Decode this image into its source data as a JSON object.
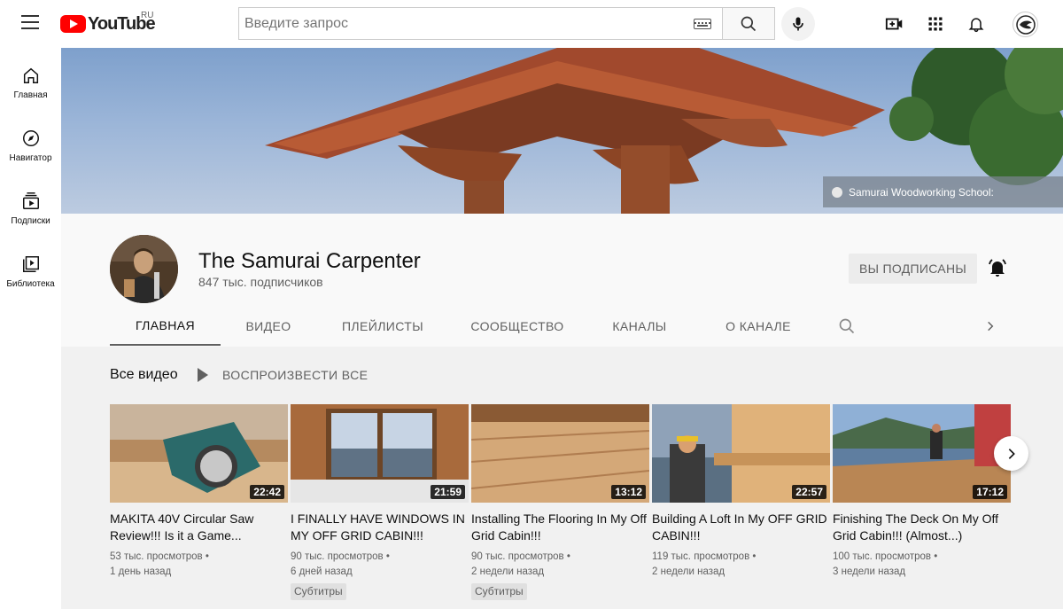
{
  "header": {
    "logo_text": "YouTube",
    "region": "RU",
    "search_placeholder": "Введите запрос",
    "icons": [
      "menu-icon",
      "keyboard-icon",
      "search-icon",
      "mic-icon",
      "create-video-icon",
      "apps-grid-icon",
      "notifications-bell-icon",
      "account-avatar-icon"
    ]
  },
  "sidebar": {
    "items": [
      {
        "label": "Главная",
        "icon": "home-icon"
      },
      {
        "label": "Навигатор",
        "icon": "explore-compass-icon"
      },
      {
        "label": "Подписки",
        "icon": "subscriptions-icon"
      },
      {
        "label": "Библиотека",
        "icon": "library-icon"
      }
    ]
  },
  "banner": {
    "link_text": "Samurai Woodworking School:"
  },
  "channel": {
    "name": "The Samurai Carpenter",
    "subscribers": "847 тыс. подписчиков",
    "subscribed_label": "ВЫ ПОДПИСАНЫ"
  },
  "tabs": [
    {
      "label": "ГЛАВНАЯ",
      "active": true
    },
    {
      "label": "ВИДЕО"
    },
    {
      "label": "ПЛЕЙЛИСТЫ"
    },
    {
      "label": "СООБЩЕСТВО"
    },
    {
      "label": "КАНАЛЫ"
    },
    {
      "label": "О КАНАЛЕ"
    }
  ],
  "section": {
    "title": "Все видео",
    "play_all": "ВОСПРОИЗВЕСТИ ВСЕ"
  },
  "videos": [
    {
      "title": "MAKITA 40V Circular Saw Review!!! Is it a Game...",
      "duration": "22:42",
      "views": "53 тыс. просмотров",
      "age": "1 день назад",
      "badge": ""
    },
    {
      "title": "I FINALLY HAVE WINDOWS IN MY OFF GRID CABIN!!!",
      "duration": "21:59",
      "views": "90 тыс. просмотров",
      "age": "6 дней назад",
      "badge": "Субтитры"
    },
    {
      "title": "Installing The Flooring In My Off Grid Cabin!!!",
      "duration": "13:12",
      "views": "90 тыс. просмотров",
      "age": "2 недели назад",
      "badge": "Субтитры"
    },
    {
      "title": "Building A Loft In My OFF GRID CABIN!!!",
      "duration": "22:57",
      "views": "119 тыс. просмотров",
      "age": "2 недели назад",
      "badge": ""
    },
    {
      "title": "Finishing The Deck On My Off Grid Cabin!!! (Almost...)",
      "duration": "17:12",
      "views": "100 тыс. просмотров",
      "age": "3 недели назад",
      "badge": ""
    }
  ],
  "colors": {
    "brand_red": "#ff0000",
    "background": "#f9f9f9",
    "text_secondary": "#606060"
  }
}
